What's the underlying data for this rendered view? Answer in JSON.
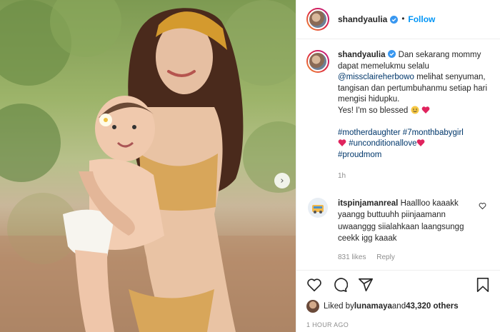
{
  "post": {
    "username": "shandyaulia",
    "follow_label": "Follow",
    "dot": "•",
    "caption_parts": {
      "intro": " Dan sekarang mommy dapat memelukmu selalu ",
      "mention": "@missclaireherbowo",
      "body": " melihat senyuman, tangisan dan pertumbuhanmu setiap hari mengisi hidupku.",
      "blessed": "Yes! I'm so blessed ",
      "hashtag1": "#motherdaughter",
      "hashtag2": "#7monthbabygirl",
      "hashtag3": "#unconditionallove",
      "hashtag4": "#proudmom"
    },
    "caption_time": "1h",
    "comment": {
      "username": "itspinjamanreal",
      "text": " Haallloo kaaakk yaangg buttuuhh piinjaamann uwaanggg siialahkaan laangsungg ceekk igg kaaak",
      "likes": "831 likes",
      "reply": "Reply"
    },
    "likes": {
      "prefix": "Liked by ",
      "user": "lunamaya",
      "and": " and ",
      "count": "43,320 others"
    },
    "posted_time": "1 HOUR AGO"
  },
  "icons": [
    "verified-badge-icon",
    "heart-icon",
    "comment-icon",
    "share-icon",
    "bookmark-icon",
    "chevron-right-icon",
    "smile-emoji-icon",
    "red-heart-icon"
  ],
  "colors": {
    "link": "#0095f6",
    "hashtag": "#00376b",
    "muted": "#8e8e8e",
    "heart": "#e0245e"
  }
}
